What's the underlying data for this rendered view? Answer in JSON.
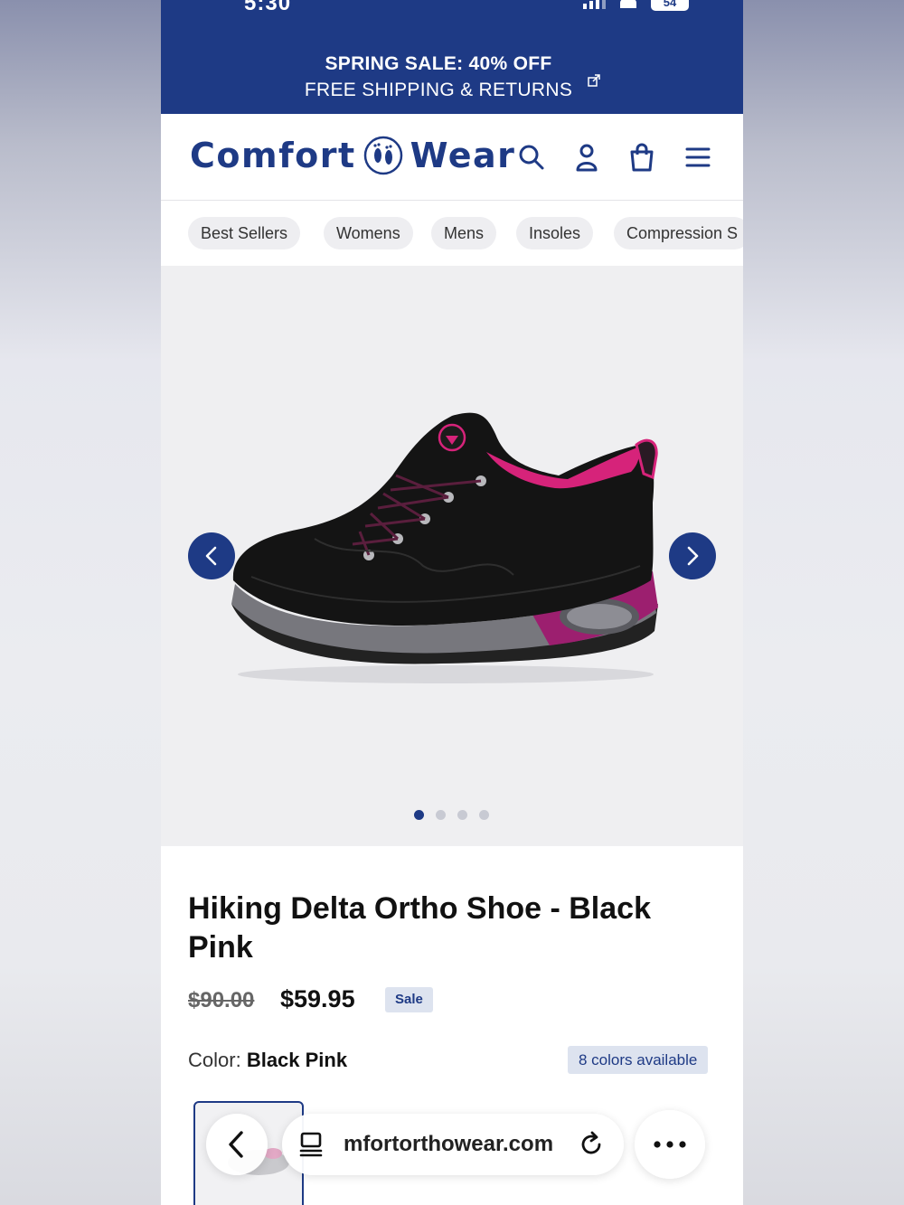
{
  "status_bar": {
    "time": "5:30",
    "battery": "54"
  },
  "announcement": {
    "line1": "SPRING SALE: 40% OFF",
    "line2": "FREE SHIPPING & RETURNS"
  },
  "header": {
    "logo_left": "Comfort",
    "logo_right": "Wear",
    "icons": [
      "search-icon",
      "account-icon",
      "cart-icon",
      "menu-icon"
    ]
  },
  "categories": [
    "Best Sellers",
    "Womens",
    "Mens",
    "Insoles",
    "Compression S"
  ],
  "gallery": {
    "dots_total": 4,
    "active_dot": 0
  },
  "product": {
    "title": "Hiking Delta Ortho Shoe - Black Pink",
    "old_price": "$90.00",
    "price": "$59.95",
    "badge": "Sale",
    "color_label": "Color:",
    "color_value": "Black Pink",
    "colors_available": "8 colors available"
  },
  "browser": {
    "url": "mfortorthowear.com"
  },
  "colors": {
    "brand": "#1e3a85",
    "accent_pink": "#d6237a"
  }
}
